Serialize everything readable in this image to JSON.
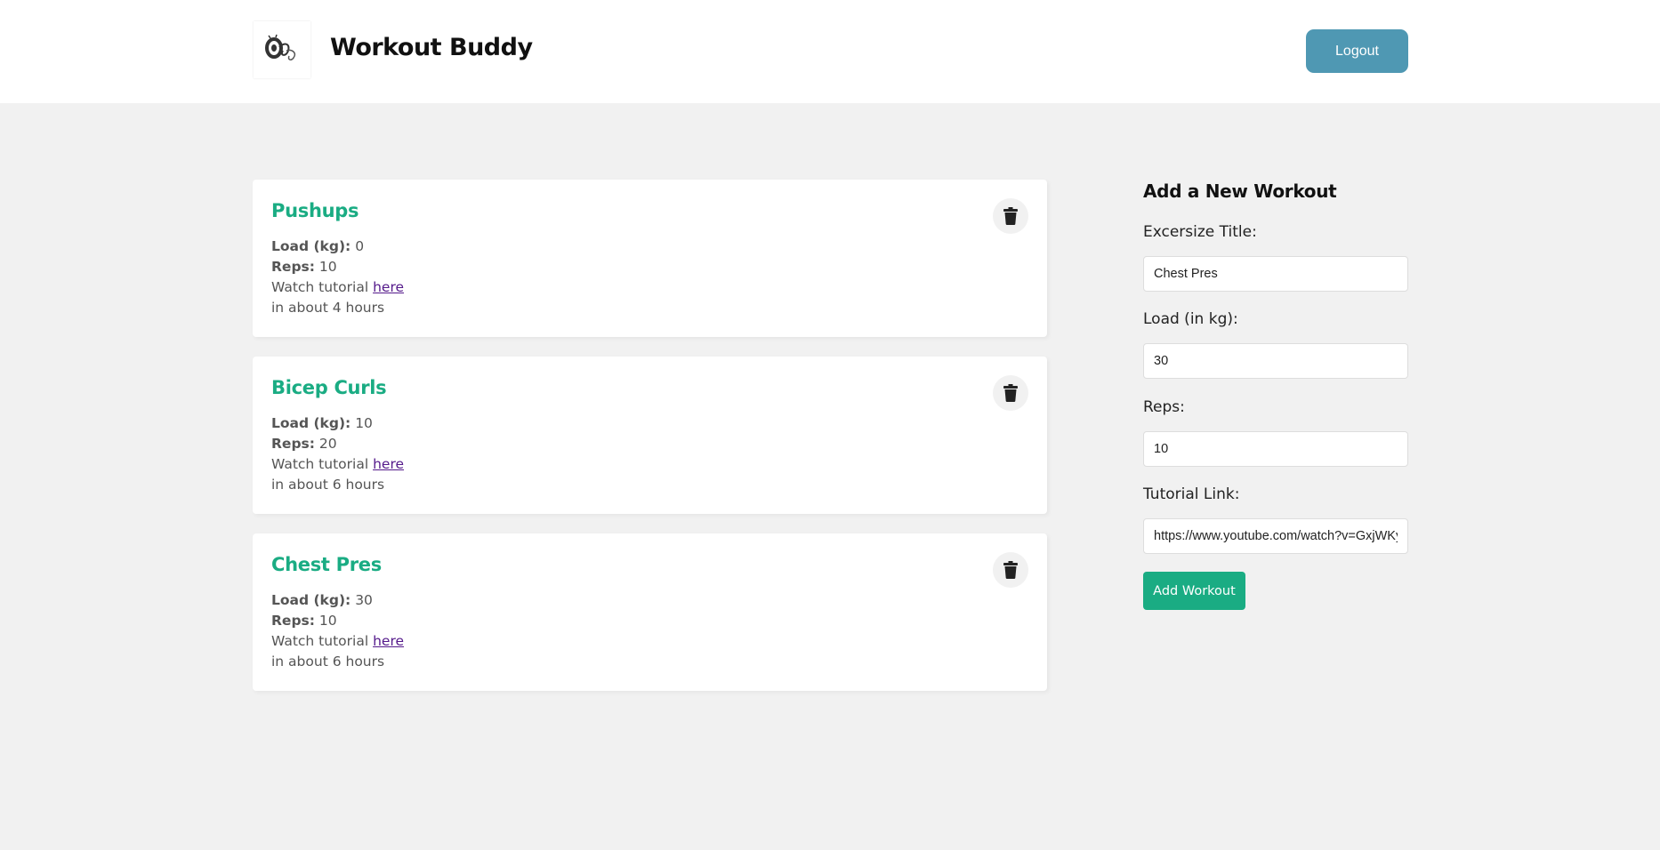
{
  "header": {
    "logo_icon": "dumbbell-logo-icon",
    "brand": "Workout Buddy",
    "logout_label": "Logout",
    "logout_color": "#4f98b3"
  },
  "workouts": [
    {
      "title": "Pushups",
      "load_label": "Load (kg):",
      "load": "0",
      "reps_label": "Reps:",
      "reps": "10",
      "tutorial_prefix": "Watch tutorial",
      "tutorial_link": "here",
      "time": "in about 4 hours",
      "delete_icon": "trash-icon"
    },
    {
      "title": "Bicep Curls",
      "load_label": "Load (kg):",
      "load": "10",
      "reps_label": "Reps:",
      "reps": "20",
      "tutorial_prefix": "Watch tutorial",
      "tutorial_link": "here",
      "time": "in about 6 hours",
      "delete_icon": "trash-icon"
    },
    {
      "title": "Chest Pres",
      "load_label": "Load (kg):",
      "load": "30",
      "reps_label": "Reps:",
      "reps": "10",
      "tutorial_prefix": "Watch tutorial",
      "tutorial_link": "here",
      "time": "in about 6 hours",
      "delete_icon": "trash-icon"
    }
  ],
  "form": {
    "title": "Add a New Workout",
    "title_label": "Excersize Title:",
    "title_value": "Chest Pres",
    "load_label": "Load (in kg):",
    "load_value": "30",
    "reps_label": "Reps:",
    "reps_value": "10",
    "link_label": "Tutorial Link:",
    "link_value": "https://www.youtube.com/watch?v=GxjWKy",
    "submit_label": "Add Workout"
  },
  "colors": {
    "accent": "#1aac83",
    "background": "#f1f1f1",
    "link": "#551a8b"
  }
}
